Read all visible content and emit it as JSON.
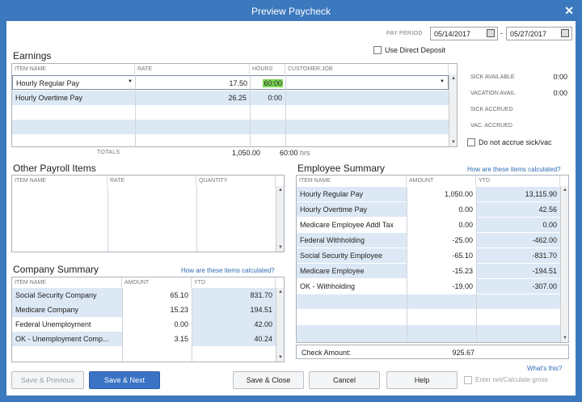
{
  "window": {
    "title": "Preview Paycheck"
  },
  "pay_period": {
    "label": "PAY PERIOD",
    "start": "05/14/2017",
    "separator": "-",
    "end": "05/27/2017"
  },
  "direct_deposit": {
    "label": "Use Direct Deposit",
    "checked": false
  },
  "earnings": {
    "title": "Earnings",
    "headers": [
      "ITEM NAME",
      "RATE",
      "HOURS",
      "CUSTOMER:JOB"
    ],
    "rows": [
      {
        "item": "Hourly Regular Pay",
        "rate": "17.50",
        "hours": "60:00",
        "job": ""
      },
      {
        "item": "Hourly Overtime Pay",
        "rate": "26.25",
        "hours": "0:00",
        "job": ""
      }
    ],
    "totals_label": "TOTALS",
    "total_amount": "1,050.00",
    "total_hours": "60:00",
    "hours_unit": "hrs"
  },
  "sick_vac": {
    "items": [
      {
        "label": "SICK AVAILABLE",
        "value": "0:00"
      },
      {
        "label": "VACATION AVAIL.",
        "value": "0:00"
      },
      {
        "label": "SICK ACCRUED",
        "value": ""
      },
      {
        "label": "VAC. ACCRUED",
        "value": ""
      }
    ],
    "no_accrue_label": "Do not accrue sick/vac"
  },
  "other_payroll": {
    "title": "Other Payroll Items",
    "headers": [
      "ITEM NAME",
      "RATE",
      "QUANTITY"
    ]
  },
  "employee_summary": {
    "title": "Employee Summary",
    "link": "How are these items calculated?",
    "headers": [
      "ITEM NAME",
      "AMOUNT",
      "YTD"
    ],
    "rows": [
      {
        "item": "Hourly Regular Pay",
        "amount": "1,050.00",
        "ytd": "13,115.90"
      },
      {
        "item": "Hourly Overtime Pay",
        "amount": "0.00",
        "ytd": "42.56"
      },
      {
        "item": "Medicare Employee Addl Tax",
        "amount": "0.00",
        "ytd": "0.00"
      },
      {
        "item": "Federal Withholding",
        "amount": "-25.00",
        "ytd": "-462.00"
      },
      {
        "item": "Social Security Employee",
        "amount": "-65.10",
        "ytd": "-831.70"
      },
      {
        "item": "Medicare Employee",
        "amount": "-15.23",
        "ytd": "-194.51"
      },
      {
        "item": "OK - Withholding",
        "amount": "-19.00",
        "ytd": "-307.00"
      }
    ],
    "check_amount_label": "Check Amount:",
    "check_amount": "925.67"
  },
  "company_summary": {
    "title": "Company Summary",
    "link": "How are these items calculated?",
    "headers": [
      "ITEM NAME",
      "AMOUNT",
      "YTD"
    ],
    "rows": [
      {
        "item": "Social Security Company",
        "amount": "65.10",
        "ytd": "831.70"
      },
      {
        "item": "Medicare Company",
        "amount": "15.23",
        "ytd": "194.51"
      },
      {
        "item": "Federal Unemployment",
        "amount": "0.00",
        "ytd": "42.00"
      },
      {
        "item": "OK - Unemployment Comp...",
        "amount": "3.15",
        "ytd": "40.24"
      }
    ]
  },
  "buttons": {
    "save_previous": "Save & Previous",
    "save_next": "Save & Next",
    "save_close": "Save & Close",
    "cancel": "Cancel",
    "help": "Help",
    "whats_this": "What's this?",
    "enter_net": "Enter net/Calculate gross"
  },
  "colors": {
    "accent": "#3a73c4",
    "row_alt": "#dde8f5",
    "frame": "#3b78bd"
  }
}
